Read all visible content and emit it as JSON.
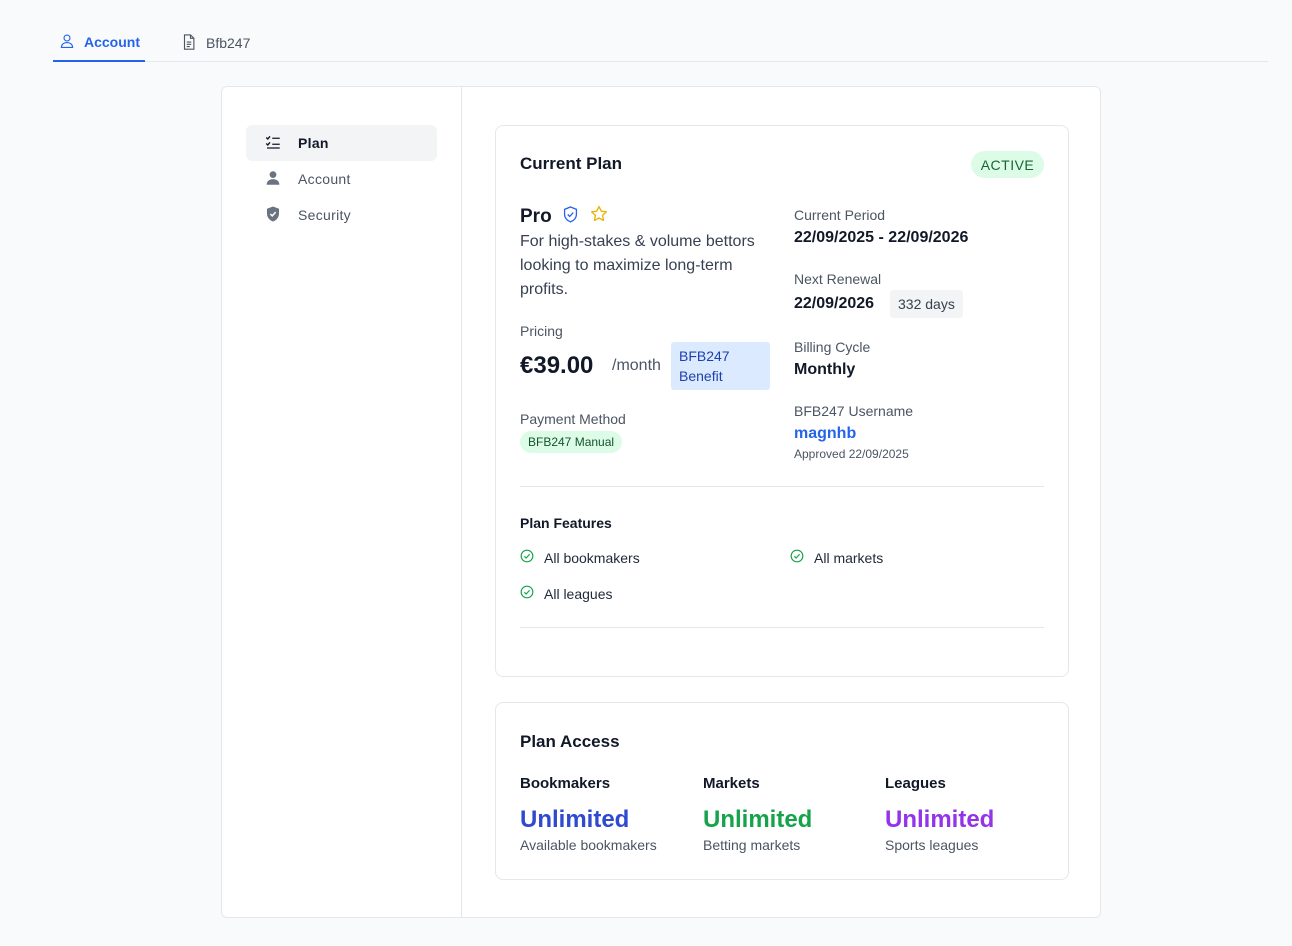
{
  "tabs": [
    {
      "label": "Account",
      "icon": "user-icon"
    },
    {
      "label": "Bfb247",
      "icon": "document-icon"
    }
  ],
  "sidebar": {
    "items": [
      {
        "label": "Plan",
        "icon": "checklist-icon"
      },
      {
        "label": "Account",
        "icon": "person-icon"
      },
      {
        "label": "Security",
        "icon": "shield-icon"
      }
    ]
  },
  "current_plan": {
    "title": "Current Plan",
    "status": "ACTIVE",
    "plan_name": "Pro",
    "description": "For high-stakes & volume bettors looking to maximize long-term profits.",
    "pricing_label": "Pricing",
    "price": "€39.00",
    "per": "/month",
    "benefit": "BFB247 Benefit",
    "payment_method_label": "Payment Method",
    "payment_method": "BFB247 Manual",
    "current_period_label": "Current Period",
    "current_period": "22/09/2025 - 22/09/2026",
    "next_renewal_label": "Next Renewal",
    "next_renewal": "22/09/2026",
    "days_left": "332 days",
    "billing_cycle_label": "Billing Cycle",
    "billing_cycle": "Monthly",
    "username_label": "BFB247 Username",
    "username": "magnhb",
    "approved": "Approved 22/09/2025",
    "features_title": "Plan Features",
    "features": [
      "All bookmakers",
      "All markets",
      "All leagues"
    ]
  },
  "plan_access": {
    "title": "Plan Access",
    "columns": [
      {
        "label": "Bookmakers",
        "value": "Unlimited",
        "sub": "Available bookmakers",
        "color": "#2f49d1"
      },
      {
        "label": "Markets",
        "value": "Unlimited",
        "sub": "Betting markets",
        "color": "#16a34a"
      },
      {
        "label": "Leagues",
        "value": "Unlimited",
        "sub": "Sports leagues",
        "color": "#9333ea"
      }
    ]
  },
  "colors": {
    "accent": "#2563eb",
    "active_badge": "#dcfce7",
    "success": "#16a34a"
  }
}
